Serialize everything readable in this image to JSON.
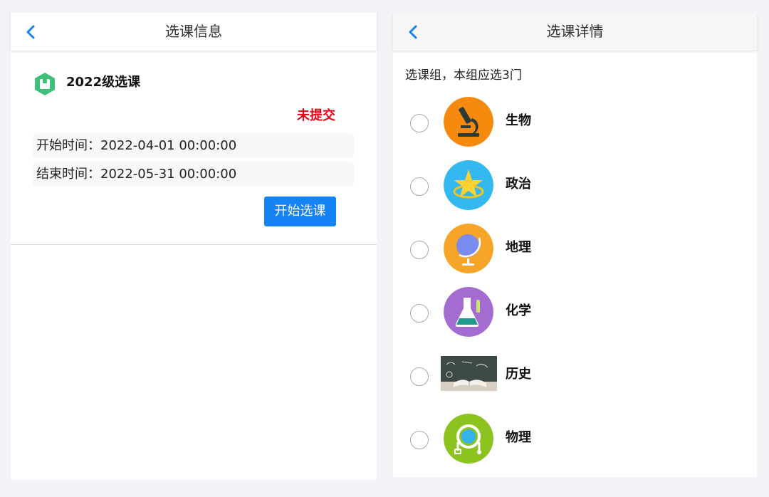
{
  "left": {
    "title": "选课信息",
    "course_title": "2022级选课",
    "status": "未提交",
    "start_time": "开始时间：2022-04-01 00:00:00",
    "end_time": "结束时间：2022-05-31 00:00:00",
    "start_button": "开始选课"
  },
  "right": {
    "title": "选课详情",
    "group_hint": "选课组，本组应选3门",
    "subjects": [
      {
        "label": "生物",
        "icon": "microscope-icon",
        "color": "#f68a0e"
      },
      {
        "label": "政治",
        "icon": "star-icon",
        "color": "#33b9f0"
      },
      {
        "label": "地理",
        "icon": "globe-icon",
        "color": "#f7a529"
      },
      {
        "label": "化学",
        "icon": "flask-icon",
        "color": "#a46cd1"
      },
      {
        "label": "历史",
        "icon": "open-book-chalkboard-image",
        "color": "#3d4a45"
      },
      {
        "label": "物理",
        "icon": "physics-apparatus-icon",
        "color": "#8cc31f"
      }
    ]
  },
  "colors": {
    "accent": "#1683f5",
    "status_red": "#e60012",
    "nav_back": "#1683f5",
    "background": "#f2f3f6"
  }
}
